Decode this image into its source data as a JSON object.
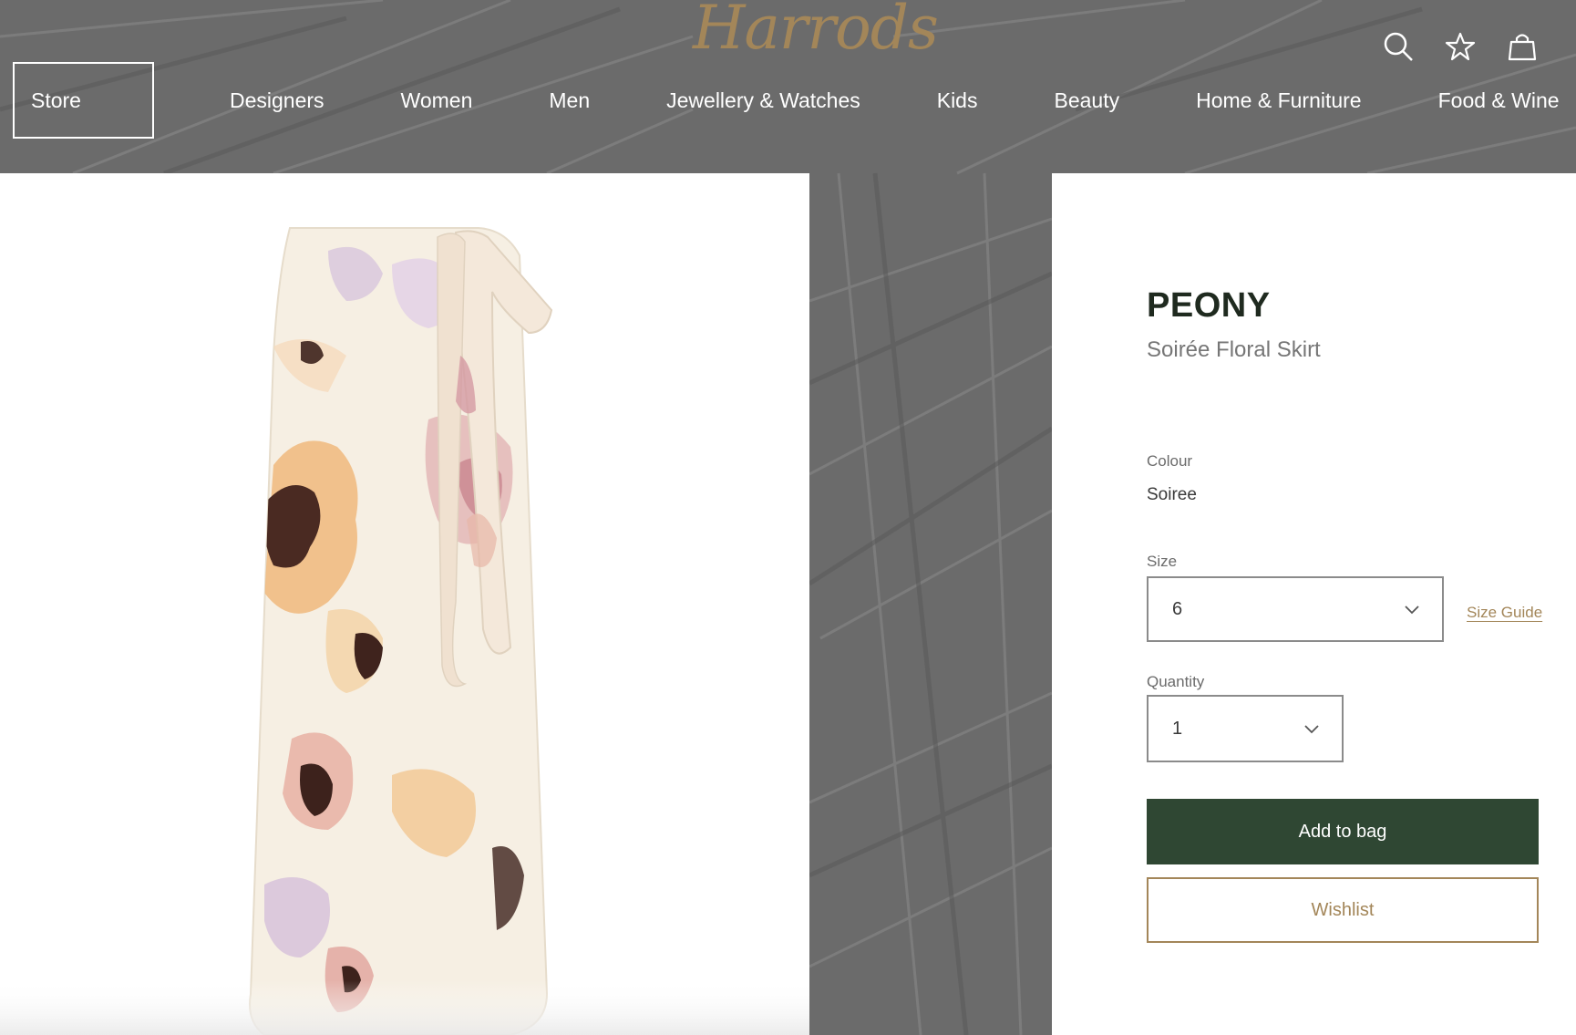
{
  "header": {
    "logo_text": "Harrods",
    "icons": [
      "search-icon",
      "star-icon",
      "bag-icon"
    ]
  },
  "nav": {
    "items": [
      {
        "label": "Store"
      },
      {
        "label": "Designers"
      },
      {
        "label": "Women"
      },
      {
        "label": "Men"
      },
      {
        "label": "Jewellery & Watches"
      },
      {
        "label": "Kids"
      },
      {
        "label": "Beauty"
      },
      {
        "label": "Home & Furniture"
      },
      {
        "label": "Food & Wine"
      }
    ]
  },
  "product": {
    "brand": "PEONY",
    "name": "Soirée Floral Skirt",
    "colour_label": "Colour",
    "colour_value": "Soiree",
    "size_label": "Size",
    "size_value": "6",
    "size_guide_label": "Size Guide",
    "quantity_label": "Quantity",
    "quantity_value": "1",
    "add_to_bag_label": "Add to bag",
    "wishlist_label": "Wishlist"
  },
  "colors": {
    "brand_gold": "#a38659",
    "add_button_green": "#2f4733",
    "background_grey": "#6d6d6d"
  }
}
